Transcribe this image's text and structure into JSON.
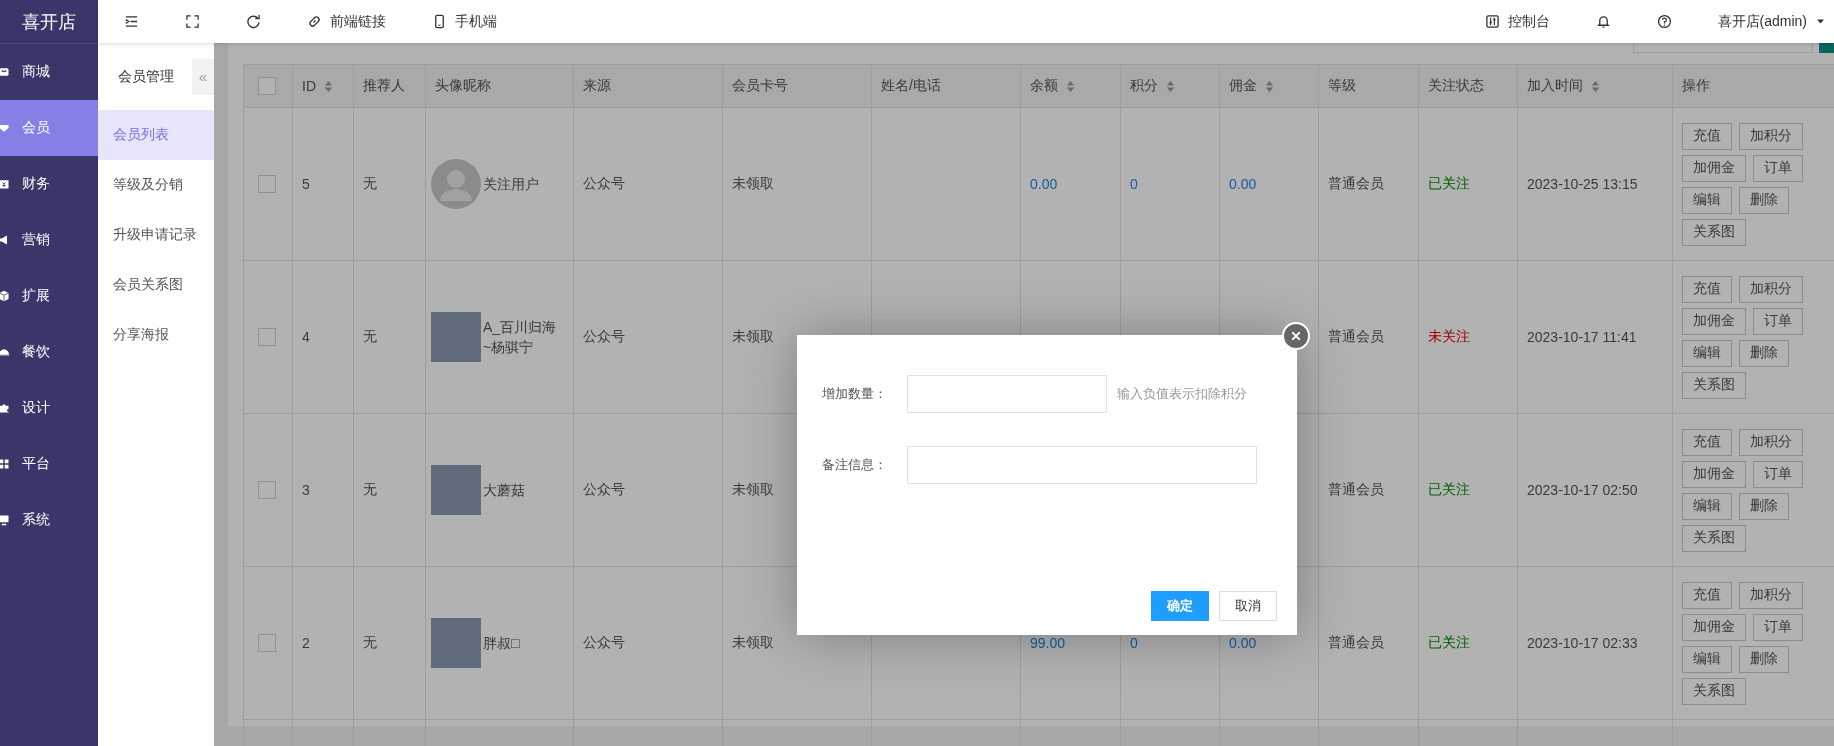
{
  "brand": "喜开店",
  "sidebar": {
    "items": [
      {
        "label": "商城",
        "selected": false
      },
      {
        "label": "会员",
        "selected": true
      },
      {
        "label": "财务",
        "selected": false
      },
      {
        "label": "营销",
        "selected": false
      },
      {
        "label": "扩展",
        "selected": false
      },
      {
        "label": "餐饮",
        "selected": false
      },
      {
        "label": "设计",
        "selected": false
      },
      {
        "label": "平台",
        "selected": false
      },
      {
        "label": "系统",
        "selected": false
      }
    ]
  },
  "topbar": {
    "links": [
      "前端链接",
      "手机端"
    ],
    "console": "控制台",
    "user": "喜开店(admin)"
  },
  "subnav": {
    "title": "会员管理",
    "collapse": "«",
    "items": [
      {
        "label": "会员列表",
        "selected": true
      },
      {
        "label": "等级及分销",
        "selected": false
      },
      {
        "label": "升级申请记录",
        "selected": false
      },
      {
        "label": "会员关系图",
        "selected": false
      },
      {
        "label": "分享海报",
        "selected": false
      }
    ]
  },
  "table": {
    "select_all_checked": false,
    "columns": [
      {
        "label": "ID",
        "sortable": true
      },
      {
        "label": "推荐人",
        "sortable": false
      },
      {
        "label": "头像昵称",
        "sortable": false
      },
      {
        "label": "来源",
        "sortable": false
      },
      {
        "label": "会员卡号",
        "sortable": false
      },
      {
        "label": "姓名/电话",
        "sortable": false
      },
      {
        "label": "余额",
        "sortable": true
      },
      {
        "label": "积分",
        "sortable": true
      },
      {
        "label": "佣金",
        "sortable": true
      },
      {
        "label": "等级",
        "sortable": false
      },
      {
        "label": "关注状态",
        "sortable": false
      },
      {
        "label": "加入时间",
        "sortable": true
      },
      {
        "label": "操作",
        "sortable": false
      }
    ],
    "rows": [
      {
        "checked": false,
        "id": "5",
        "referrer": "无",
        "kind": "default",
        "nickname": "关注用户",
        "source": "公众号",
        "card": "未领取",
        "balance": "0.00",
        "points": "0",
        "commission": "0.00",
        "level": "普通会员",
        "followed": true,
        "follow_status": "已关注",
        "joined": "2023-10-25 13:15",
        "actions": [
          "充值",
          "加积分",
          "加佣金",
          "订单",
          "编辑",
          "删除",
          "关系图"
        ]
      },
      {
        "checked": false,
        "id": "4",
        "referrer": "无",
        "kind": "photo",
        "nickname": "A_百川归海~杨骐宁",
        "source": "公众号",
        "card": "未领取",
        "level": "普通会员",
        "followed": false,
        "follow_status": "未关注",
        "joined": "2023-10-17 11:41",
        "actions": [
          "充值",
          "加积分",
          "加佣金",
          "订单",
          "编辑",
          "删除",
          "关系图"
        ]
      },
      {
        "checked": false,
        "id": "3",
        "referrer": "无",
        "kind": "photo",
        "nickname": "大蘑菇",
        "source": "公众号",
        "card": "未领取",
        "level": "普通会员",
        "followed": true,
        "follow_status": "已关注",
        "joined": "2023-10-17 02:50",
        "actions": [
          "充值",
          "加积分",
          "加佣金",
          "订单",
          "编辑",
          "删除",
          "关系图"
        ]
      },
      {
        "checked": false,
        "id": "2",
        "referrer": "无",
        "kind": "photo",
        "nickname": "胖叔□",
        "source": "公众号",
        "card": "未领取",
        "balance": "99.00",
        "points": "0",
        "commission": "0.00",
        "level": "普通会员",
        "followed": true,
        "follow_status": "已关注",
        "joined": "2023-10-17 02:33",
        "actions": [
          "充值",
          "加积分",
          "加佣金",
          "订单",
          "编辑",
          "删除",
          "关系图"
        ]
      }
    ]
  },
  "dialog": {
    "fields": [
      {
        "label": "增加数量：",
        "hint": "输入负值表示扣除积分"
      },
      {
        "label": "备注信息："
      }
    ],
    "buttons": [
      {
        "label": "确定",
        "primary": true
      },
      {
        "label": "取消",
        "primary": false
      }
    ]
  }
}
